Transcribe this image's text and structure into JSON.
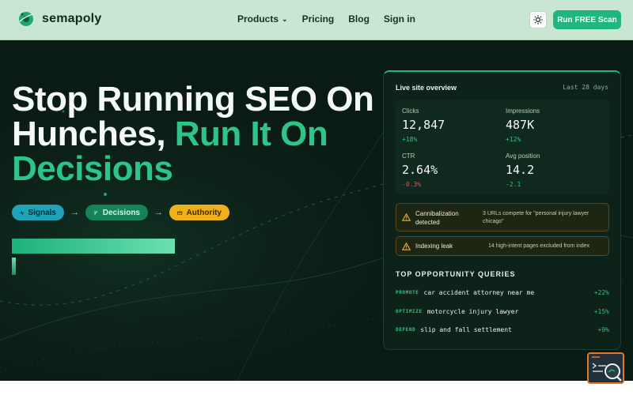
{
  "brand": {
    "name": "semapoly"
  },
  "nav": {
    "items": [
      {
        "label": "Products",
        "has_dropdown": true
      },
      {
        "label": "Pricing"
      },
      {
        "label": "Blog"
      },
      {
        "label": "Sign in"
      }
    ],
    "theme_icon": "sun-icon",
    "cta_label": "Run FREE Scan"
  },
  "hero": {
    "headline_part1": "Stop Running SEO On",
    "headline_part2": "Hunches, ",
    "headline_accent1": "Run It On",
    "headline_accent2": "Decisions",
    "pills": [
      {
        "label": "Signals",
        "icon": "activity-icon"
      },
      {
        "label": "Decisions",
        "icon": "branch-icon"
      },
      {
        "label": "Authority",
        "icon": "crown-icon"
      }
    ],
    "arrow": "→"
  },
  "card": {
    "title": "Live site overview",
    "range": "Last 28 days",
    "metrics": [
      {
        "label": "Clicks",
        "value": "12,847",
        "delta": "+18%"
      },
      {
        "label": "Impressions",
        "value": "487K",
        "delta": "+12%"
      },
      {
        "label": "CTR",
        "value": "2.64%",
        "delta": "-0.3%"
      },
      {
        "label": "Avg position",
        "value": "14.2",
        "delta": "-2.1"
      }
    ],
    "alerts": [
      {
        "title": "Cannibalization detected",
        "description": "3 URLs compete for \"personal injury lawyer chicago\"",
        "icon": "warning-icon"
      },
      {
        "title": "Indexing leak",
        "description": "14 high-intent pages excluded from index",
        "icon": "warning-icon"
      }
    ],
    "queries_title": "TOP OPPORTUNITY QUERIES",
    "queries": [
      {
        "tag": "PROMOTE",
        "text": "car accident attorney near me",
        "delta": "+22%"
      },
      {
        "tag": "OPTIMIZE",
        "text": "motorcycle injury lawyer",
        "delta": "+15%"
      },
      {
        "tag": "DEFEND",
        "text": "slip and fall settlement",
        "delta": "+9%"
      }
    ]
  },
  "colors": {
    "accent": "#2ec489",
    "cta": "#1fb77f",
    "nav_bg": "#c9e6d2",
    "hero_bg": "#0a1a14",
    "warning": "#f0b01a",
    "negative": "#e35454"
  }
}
